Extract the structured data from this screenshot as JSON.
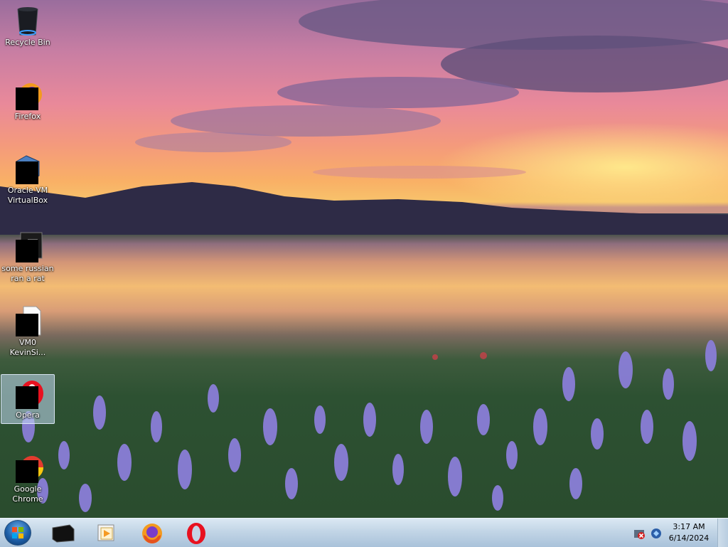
{
  "desktop": {
    "icons": [
      {
        "label": "Recycle Bin",
        "icon": "recycle-bin-icon"
      },
      {
        "label": "Firefox",
        "icon": "firefox-icon"
      },
      {
        "label": "Oracle VM\nVirtualBox",
        "icon": "virtualbox-icon"
      },
      {
        "label": "some russian\nran a rat",
        "icon": "terminal-file-icon"
      },
      {
        "label": "VM0\nKevinSi...",
        "icon": "document-file-icon"
      },
      {
        "label": "Opera",
        "icon": "opera-icon"
      },
      {
        "label": "Google\nChrome",
        "icon": "chrome-icon"
      }
    ],
    "selected_icon": "Opera"
  },
  "taskbar": {
    "pinned": [
      {
        "name": "start-button",
        "icon": "windows-orb-icon"
      },
      {
        "name": "cmd",
        "icon": "command-prompt-icon"
      },
      {
        "name": "media-player",
        "icon": "media-player-icon"
      },
      {
        "name": "firefox",
        "icon": "firefox-icon"
      },
      {
        "name": "opera",
        "icon": "opera-icon"
      }
    ],
    "tray": {
      "icons": [
        "network-error-icon",
        "network-icon"
      ],
      "time": "3:17 AM",
      "date": "6/14/2024"
    }
  },
  "colors": {
    "sky_top": "#9a6d9d",
    "sunset_glow": "#f7c36b",
    "taskbar": "#c2d5e6",
    "selection": "#c4dcf5"
  }
}
